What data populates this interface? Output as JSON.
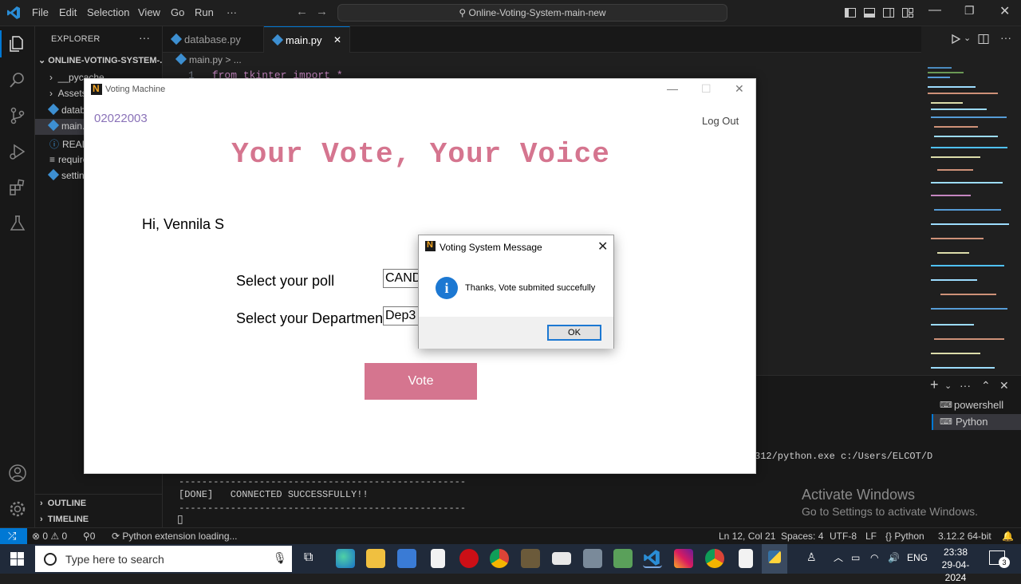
{
  "titlebar": {
    "menu": [
      "File",
      "Edit",
      "Selection",
      "View",
      "Go",
      "Run",
      "···"
    ],
    "command_center": "Online-Voting-System-main-new"
  },
  "explorer": {
    "header": "EXPLORER",
    "more": "···",
    "project": "ONLINE-VOTING-SYSTEM-...",
    "items": [
      "__pycache__",
      "Assets",
      "database.py",
      "main.py",
      "README.md",
      "requirements.txt",
      "settings.json"
    ],
    "outline": "OUTLINE",
    "timeline": "TIMELINE"
  },
  "editor": {
    "tabs": [
      {
        "label": "database.py",
        "close": ""
      },
      {
        "label": "main.py",
        "close": "✕"
      }
    ],
    "breadcrumb": "main.py > ...",
    "line_number": "1",
    "code_line": "from tkinter import *"
  },
  "terminal": {
    "path_fragment": "312/python.exe c:/Users/ELCOT/D",
    "separator": "--------------------------------------------------",
    "done_line": "[DONE]   CONNECTED SUCCESSFULLY!!",
    "cursor": "▯",
    "sessions": [
      "powershell",
      "Python"
    ]
  },
  "watermark": {
    "line1": "Activate Windows",
    "line2": "Go to Settings to activate Windows."
  },
  "statusbar": {
    "problems": "⊗ 0 ⚠ 0",
    "ports": "⚲0",
    "python_ext": "⟳ Python extension loading...",
    "position": "Ln 12, Col 21",
    "spaces": "Spaces: 4",
    "encoding": "UTF-8",
    "eol": "LF",
    "language": "Python",
    "interpreter": "3.12.2 64-bit"
  },
  "taskbar": {
    "search_placeholder": "Type here to search",
    "lang": "ENG",
    "time": "23:38",
    "date": "29-04-2024",
    "notification_count": "3"
  },
  "voting_window": {
    "title": "Voting Machine",
    "user_id": "02022003",
    "logout": "Log Out",
    "banner": "Your Vote, Your Voice",
    "greeting": "Hi, Vennila S",
    "poll_label": "Select your poll",
    "poll_value": "CAND",
    "dept_label": "Select your Department",
    "dept_value": "Dep3",
    "vote_button": "Vote"
  },
  "message_box": {
    "title": "Voting System Message",
    "text": "Thanks, Vote submited succefully",
    "ok": "OK",
    "icon": "i"
  },
  "colors": {
    "vscode_accent": "#0078d4",
    "banner_pink": "#d5758f",
    "user_id_purple": "#8a72b8"
  }
}
